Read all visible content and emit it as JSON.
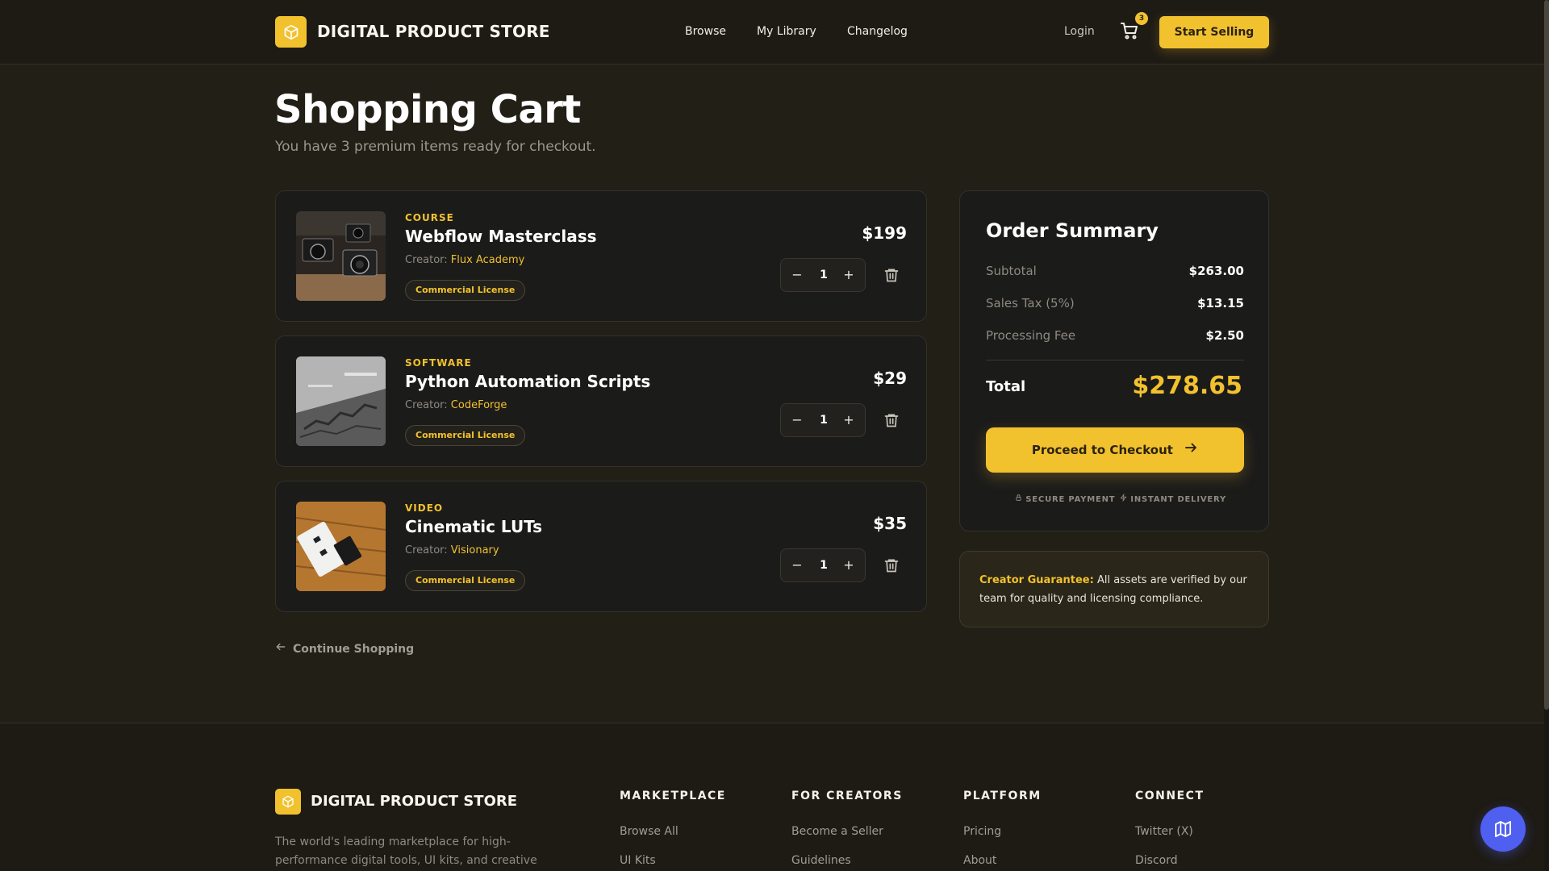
{
  "header": {
    "brand": "DIGITAL PRODUCT STORE",
    "nav": [
      "Browse",
      "My Library",
      "Changelog"
    ],
    "login": "Login",
    "cart_count": "3",
    "start_selling": "Start Selling"
  },
  "page": {
    "title": "Shopping Cart",
    "subtitle": "You have 3 premium items ready for checkout."
  },
  "items": [
    {
      "category": "COURSE",
      "name": "Webflow Masterclass",
      "creator_label": "Creator:",
      "creator": "Flux Academy",
      "license": "Commercial License",
      "price": "$199",
      "qty": "1",
      "thumb": "camera-photo"
    },
    {
      "category": "SOFTWARE",
      "name": "Python Automation Scripts",
      "creator_label": "Creator:",
      "creator": "CodeForge",
      "license": "Commercial License",
      "price": "$29",
      "qty": "1",
      "thumb": "concrete-stairs-photo"
    },
    {
      "category": "VIDEO",
      "name": "Cinematic LUTs",
      "creator_label": "Creator:",
      "creator": "Visionary",
      "license": "Commercial License",
      "price": "$35",
      "qty": "1",
      "thumb": "cards-on-wood-photo"
    }
  ],
  "continue_shopping": "Continue Shopping",
  "summary": {
    "title": "Order Summary",
    "subtotal_label": "Subtotal",
    "subtotal": "$263.00",
    "tax_label": "Sales Tax (5%)",
    "tax": "$13.15",
    "fee_label": "Processing Fee",
    "fee": "$2.50",
    "total_label": "Total",
    "total": "$278.65",
    "checkout": "Proceed to Checkout",
    "secure": "SECURE PAYMENT",
    "instant": "INSTANT DELIVERY"
  },
  "guarantee": {
    "strong": "Creator Guarantee:",
    "text": " All assets are verified by our team for quality and licensing compliance."
  },
  "footer": {
    "brand": "DIGITAL PRODUCT STORE",
    "desc": "The world's leading marketplace for high-performance digital tools, UI kits, and creative",
    "columns": [
      {
        "title": "MARKETPLACE",
        "links": [
          "Browse All",
          "UI Kits"
        ]
      },
      {
        "title": "FOR CREATORS",
        "links": [
          "Become a Seller",
          "Guidelines"
        ]
      },
      {
        "title": "PLATFORM",
        "links": [
          "Pricing",
          "About"
        ]
      },
      {
        "title": "CONNECT",
        "links": [
          "Twitter (X)",
          "Discord"
        ]
      }
    ]
  },
  "colors": {
    "accent": "#f2c12e",
    "background": "#221f17",
    "card": "#1b1b1a",
    "fab": "#4f5ff0"
  }
}
